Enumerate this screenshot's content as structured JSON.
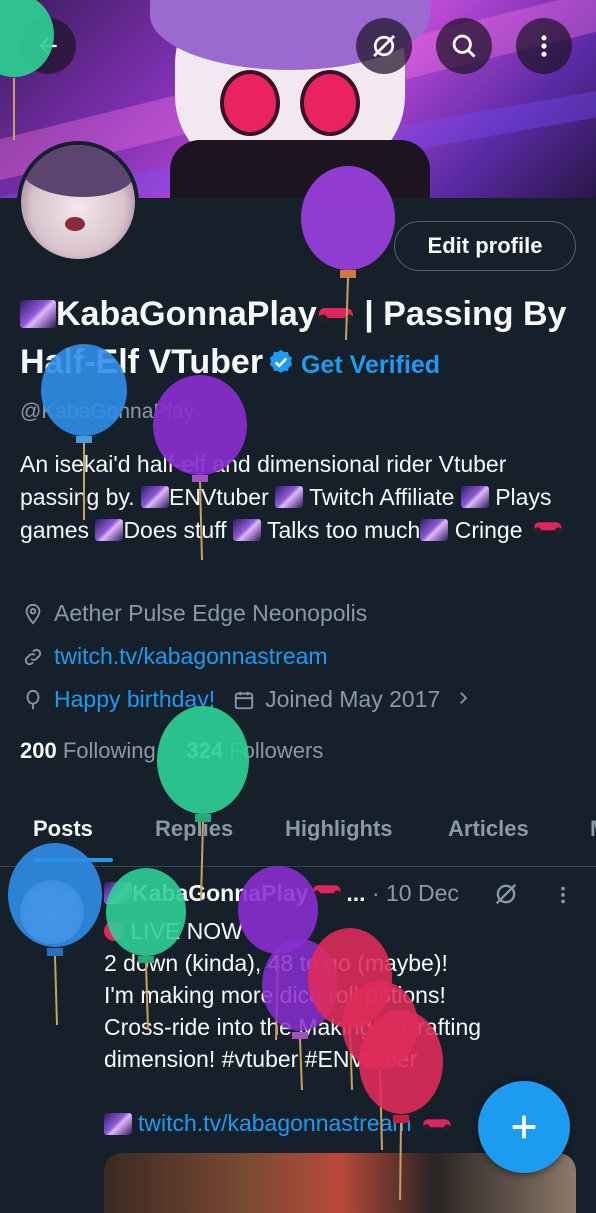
{
  "header": {
    "back_icon": "arrow-left-icon",
    "grok_icon": "grok-icon",
    "search_icon": "search-icon",
    "more_icon": "more-vertical-icon"
  },
  "profile": {
    "edit_button": "Edit profile",
    "name_part1": "KabaGonnaPlay",
    "name_separator": " | Passing By Half-Elf VTuber",
    "get_verified": "Get Verified",
    "handle": "@KabaGonnaPlay",
    "bio_line1": "An isekai'd half-elf and dimensional rider Vtuber passing by.",
    "bio_items": [
      "ENVtuber",
      "Twitch Affiliate",
      "Plays games",
      "Does stuff",
      "Talks too much",
      "Cringe"
    ],
    "location": "Aether Pulse Edge Neonopolis",
    "website": "twitch.tv/kabagonnastream",
    "birthday": "Happy birthday!",
    "joined": "Joined May 2017",
    "following_count": "200",
    "following_label": "Following",
    "followers_count": "324",
    "followers_label": "Followers"
  },
  "tabs": [
    "Posts",
    "Replies",
    "Highlights",
    "Articles",
    "M"
  ],
  "post": {
    "author": "KabaGonnaPlay",
    "ellipsis": "...",
    "date": "· 10 Dec",
    "line1": "LIVE NOW",
    "line2": "2 down (kinda), 48 to go (maybe)!",
    "line3": "I'm making more dice roll potions!",
    "line4": "Cross-ride into the Making & Crafting dimension! #vtuber #ENVtuber",
    "link": "twitch.tv/kabagonnastream"
  },
  "fab_icon": "plus-icon",
  "colors": {
    "background": "#15202b",
    "accent": "#1d9bf0",
    "muted": "#8b98a5"
  }
}
